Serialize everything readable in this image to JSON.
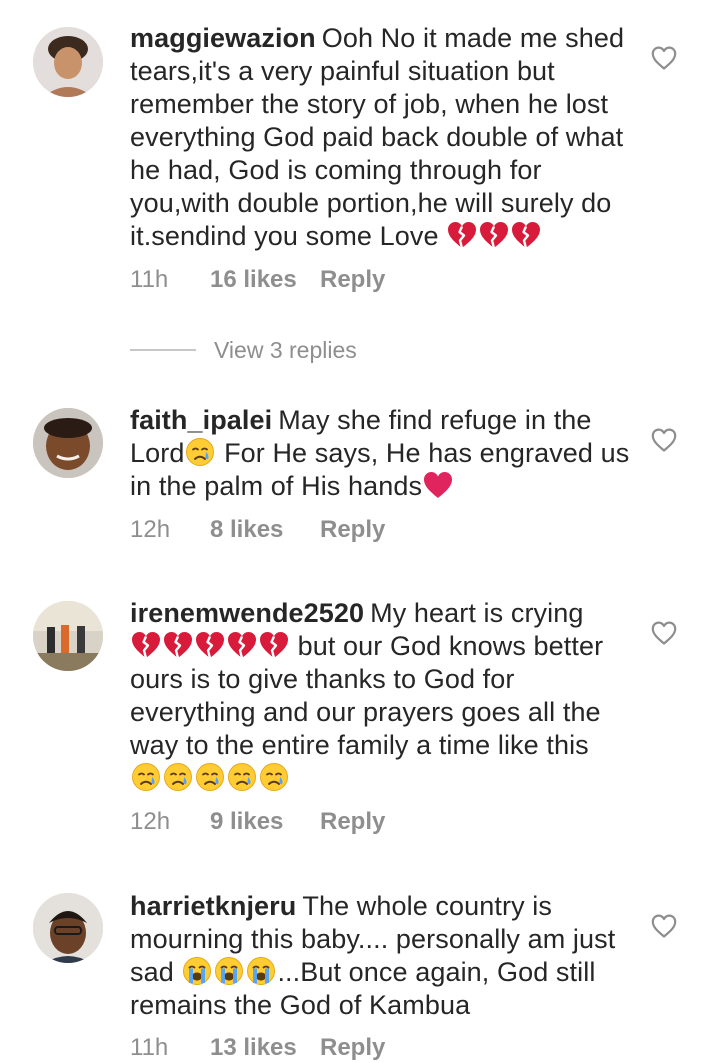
{
  "comments": [
    {
      "username": "maggiewazion",
      "text": "Ooh No it made me shed tears,it's a very painful situation but remember the story of job, when he lost everything God paid back double of what he had, God is coming through for you,with double portion,he will surely do it.sendind you some Love",
      "emojis": [
        "broken-heart",
        "broken-heart",
        "broken-heart"
      ],
      "time": "11h",
      "likes": "16 likes",
      "reply": "Reply"
    },
    {
      "username": "faith_ipalei",
      "text_a": "May she find refuge in the Lord",
      "text_b": "For He says, He has engraved us in the palm of His hands",
      "emojis_a": [
        "crying-face"
      ],
      "emojis_b": [
        "red-heart"
      ],
      "time": "12h",
      "likes": "8 likes",
      "reply": "Reply"
    },
    {
      "username": "irenemwende2520",
      "text_a": "My heart is crying",
      "text_b": "but our God knows better ours is to give thanks to God for everything and our prayers goes all the way to the entire family a time like this",
      "emojis_a": [
        "broken-heart",
        "broken-heart",
        "broken-heart",
        "broken-heart",
        "broken-heart"
      ],
      "emojis_b": [
        "crying-face",
        "crying-face",
        "crying-face",
        "crying-face",
        "crying-face"
      ],
      "time": "12h",
      "likes": "9 likes",
      "reply": "Reply"
    },
    {
      "username": "harrietknjeru",
      "text_a": "The whole country is mourning this baby.... personally am just sad",
      "text_b": "...But once again, God still remains the God of Kambua",
      "emojis": [
        "loudly-crying-face",
        "loudly-crying-face",
        "loudly-crying-face"
      ],
      "time": "11h",
      "likes": "13 likes",
      "reply": "Reply"
    }
  ],
  "view_replies": "View 3 replies",
  "icons": {
    "like": "heart-outline-icon"
  },
  "colors": {
    "text": "#262626",
    "muted": "#8e8e8e",
    "heart_red": "#e0245e"
  }
}
